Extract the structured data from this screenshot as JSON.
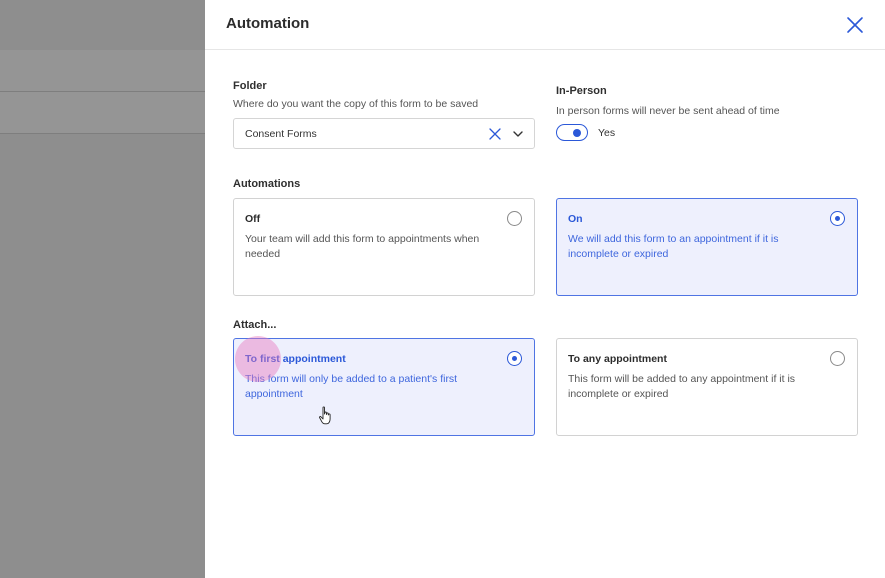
{
  "drawer": {
    "title": "Automation",
    "close_icon": "close-icon"
  },
  "folder": {
    "label": "Folder",
    "help": "Where do you want the copy of this form to be saved",
    "selected_value": "Consent Forms"
  },
  "in_person": {
    "label": "In-Person",
    "help": "In person forms will never be sent ahead of time",
    "toggle_on": true,
    "toggle_label": "Yes"
  },
  "automations": {
    "label": "Automations",
    "options": [
      {
        "title": "Off",
        "description": "Your team will add this form to appointments when needed",
        "selected": false
      },
      {
        "title": "On",
        "description": "We will add this form to an appointment if it is incomplete or expired",
        "selected": true
      }
    ]
  },
  "attach": {
    "label": "Attach...",
    "options": [
      {
        "title": "To first appointment",
        "description": "This form will only be added to a patient's first appointment",
        "selected": true
      },
      {
        "title": "To any appointment",
        "description": "This form will be added to any appointment if it is incomplete or expired",
        "selected": false
      }
    ]
  },
  "colors": {
    "accent": "#2b58d8",
    "selected_bg": "#eef0fd",
    "overlay": "#8e8e8e"
  }
}
